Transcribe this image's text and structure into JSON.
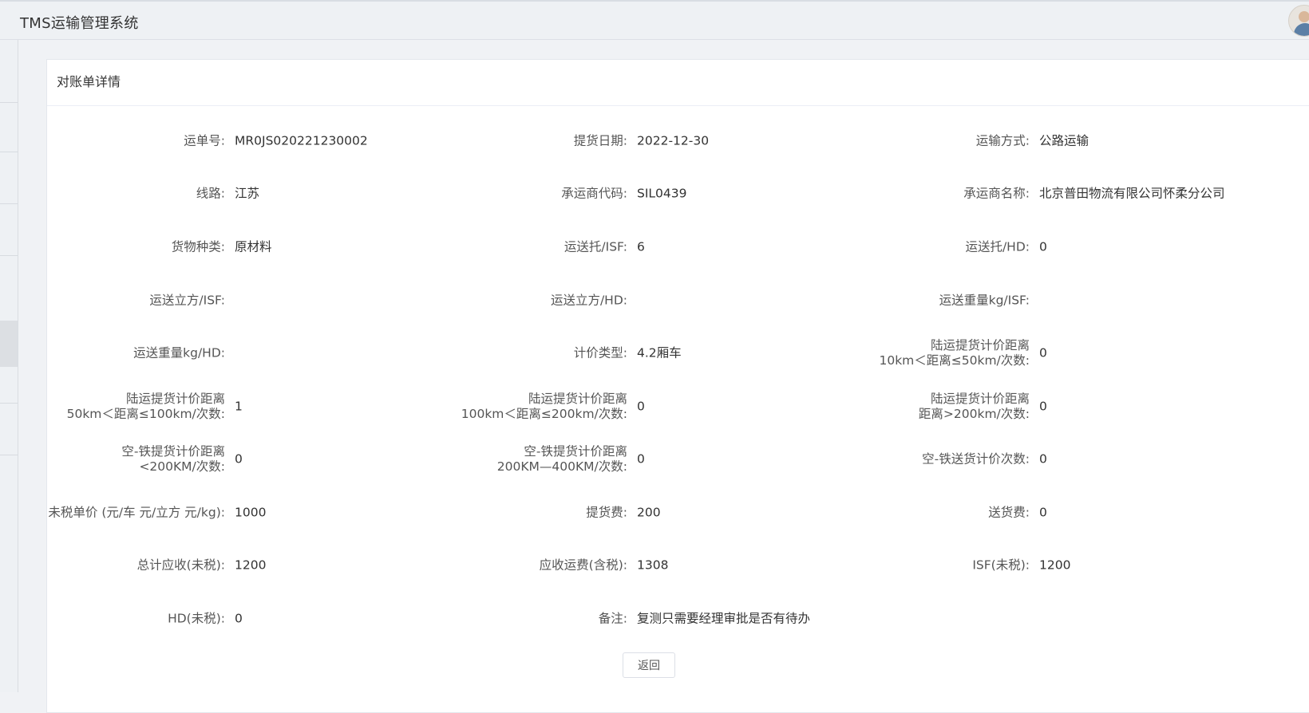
{
  "app": {
    "title": "TMS运输管理系统"
  },
  "card": {
    "title": "对账单详情"
  },
  "fields": {
    "r1": [
      {
        "label": "运单号:",
        "value": "MR0JS020221230002"
      },
      {
        "label": "提货日期:",
        "value": "2022-12-30"
      },
      {
        "label": "运输方式:",
        "value": "公路运输"
      }
    ],
    "r2": [
      {
        "label": "线路:",
        "value": "江苏"
      },
      {
        "label": "承运商代码:",
        "value": "SIL0439"
      },
      {
        "label": "承运商名称:",
        "value": "北京普田物流有限公司怀柔分公司"
      }
    ],
    "r3": [
      {
        "label": "货物种类:",
        "value": "原材料"
      },
      {
        "label": "运送托/ISF:",
        "value": "6"
      },
      {
        "label": "运送托/HD:",
        "value": "0"
      }
    ],
    "r4": [
      {
        "label": "运送立方/ISF:",
        "value": ""
      },
      {
        "label": "运送立方/HD:",
        "value": ""
      },
      {
        "label": "运送重量kg/ISF:",
        "value": ""
      }
    ],
    "r5": [
      {
        "label": "运送重量kg/HD:",
        "value": ""
      },
      {
        "label": "计价类型:",
        "value": "4.2厢车"
      },
      {
        "label1": "陆运提货计价距离",
        "label2": "10km＜距离≤50km/次数:",
        "value": "0"
      }
    ],
    "r6": [
      {
        "label1": "陆运提货计价距离",
        "label2": "50km＜距离≤100km/次数:",
        "value": "1"
      },
      {
        "label1": "陆运提货计价距离",
        "label2": "100km＜距离≤200km/次数:",
        "value": "0"
      },
      {
        "label1": "陆运提货计价距离",
        "label2": "距离>200km/次数:",
        "value": "0"
      }
    ],
    "r7": [
      {
        "label1": "空-铁提货计价距离",
        "label2": "<200KM/次数:",
        "value": "0"
      },
      {
        "label1": "空-铁提货计价距离",
        "label2": "200KM—400KM/次数:",
        "value": "0"
      },
      {
        "label": "空-铁送货计价次数:",
        "value": "0"
      }
    ],
    "r8": [
      {
        "label": "未税单价 (元/车 元/立方 元/kg):",
        "value": "1000"
      },
      {
        "label": "提货费:",
        "value": "200"
      },
      {
        "label": "送货费:",
        "value": "0"
      }
    ],
    "r9": [
      {
        "label": "总计应收(未税):",
        "value": "1200"
      },
      {
        "label": "应收运费(含税):",
        "value": "1308"
      },
      {
        "label": "ISF(未税):",
        "value": "1200"
      }
    ],
    "r10": [
      {
        "label": "HD(未税):",
        "value": "0"
      },
      {
        "label": "备注:",
        "value": "复测只需要经理审批是否有待办"
      }
    ]
  },
  "actions": {
    "back_label": "返回"
  }
}
